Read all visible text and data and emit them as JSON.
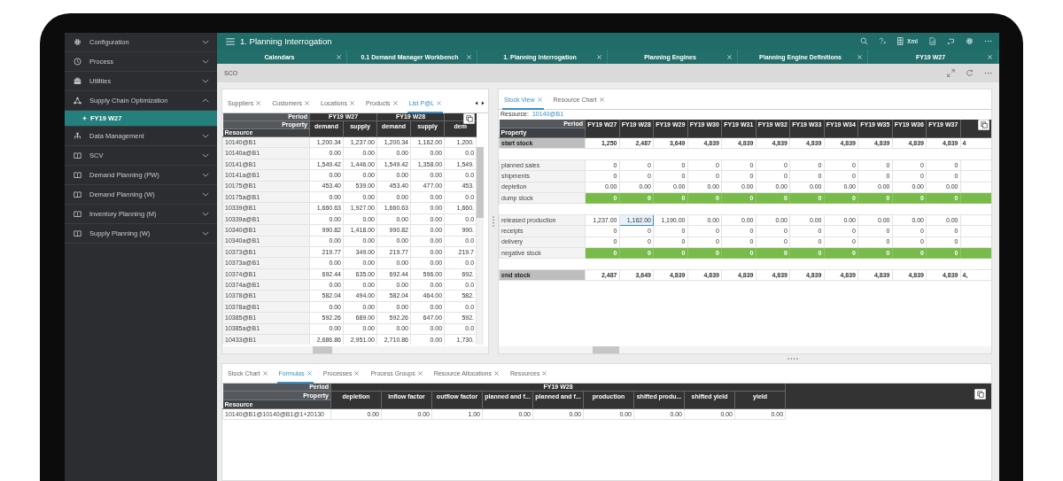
{
  "sidebar": {
    "items": [
      {
        "label": "Configuration",
        "expanded": false
      },
      {
        "label": "Process",
        "expanded": false
      },
      {
        "label": "Utilities",
        "expanded": false
      },
      {
        "label": "Supply Chain Optimization",
        "expanded": true,
        "children": [
          {
            "label": "FY19 W27",
            "selected": true
          }
        ]
      },
      {
        "label": "Data Management",
        "expanded": false
      },
      {
        "label": "SCV",
        "expanded": false
      },
      {
        "label": "Demand Planning (PW)",
        "expanded": false
      },
      {
        "label": "Demand Planning (W)",
        "expanded": false
      },
      {
        "label": "Inventory Planning (M)",
        "expanded": false
      },
      {
        "label": "Supply Planning (W)",
        "expanded": false
      }
    ]
  },
  "window": {
    "title": "1. Planning Interrogation",
    "xml_button": "Xml"
  },
  "tabs": [
    {
      "label": "Calendars"
    },
    {
      "label": "0.1 Demand Manager Workbench"
    },
    {
      "label": "1. Planning Interrogation"
    },
    {
      "label": "Planning Engines"
    },
    {
      "label": "Planning Engine Definitions"
    },
    {
      "label": "FY19 W27"
    }
  ],
  "breadcrumb": "SCO",
  "left_panel": {
    "tabs": [
      {
        "label": "Suppliers",
        "selected": false
      },
      {
        "label": "Customers",
        "selected": false
      },
      {
        "label": "Locations",
        "selected": false
      },
      {
        "label": "Products",
        "selected": false
      },
      {
        "label": "List P@L",
        "selected": true
      }
    ],
    "table": {
      "period_label": "Period",
      "property_label": "Property",
      "resource_label": "Resource",
      "periods": [
        {
          "label": "FY19 W27",
          "columns": [
            "demand",
            "supply"
          ]
        },
        {
          "label": "FY19 W28",
          "columns": [
            "demand",
            "supply"
          ]
        },
        {
          "columns": [
            "dem"
          ]
        }
      ],
      "rows": [
        {
          "resource": "10140@B1",
          "values": [
            "1,200.34",
            "1,237.00",
            "1,200.34",
            "1,162.00",
            "1,200."
          ]
        },
        {
          "resource": "10140a@B1",
          "values": [
            "0.00",
            "0.00",
            "0.00",
            "0.00",
            "0.0"
          ]
        },
        {
          "resource": "10141@B1",
          "values": [
            "1,549.42",
            "1,446.00",
            "1,549.42",
            "1,358.00",
            "1,549."
          ]
        },
        {
          "resource": "10141a@B1",
          "values": [
            "0.00",
            "0.00",
            "0.00",
            "0.00",
            "0.0"
          ]
        },
        {
          "resource": "10175@B1",
          "values": [
            "453.40",
            "539.00",
            "453.40",
            "477.00",
            "453."
          ]
        },
        {
          "resource": "10175a@B1",
          "values": [
            "0.00",
            "0.00",
            "0.00",
            "0.00",
            "0.0"
          ]
        },
        {
          "resource": "10339@B1",
          "values": [
            "1,660.63",
            "1,927.00",
            "1,660.63",
            "0.00",
            "1,660."
          ]
        },
        {
          "resource": "10339a@B1",
          "values": [
            "0.00",
            "0.00",
            "0.00",
            "0.00",
            "0.0"
          ]
        },
        {
          "resource": "10340@B1",
          "values": [
            "990.82",
            "1,418.00",
            "990.82",
            "0.00",
            "990."
          ]
        },
        {
          "resource": "10340a@B1",
          "values": [
            "0.00",
            "0.00",
            "0.00",
            "0.00",
            "0.0"
          ]
        },
        {
          "resource": "10373@B1",
          "values": [
            "219.77",
            "349.00",
            "219.77",
            "0.00",
            "219.7"
          ]
        },
        {
          "resource": "10373a@B1",
          "values": [
            "0.00",
            "0.00",
            "0.00",
            "0.00",
            "0.0"
          ]
        },
        {
          "resource": "10374@B1",
          "values": [
            "692.44",
            "635.00",
            "692.44",
            "596.00",
            "692."
          ]
        },
        {
          "resource": "10374a@B1",
          "values": [
            "0.00",
            "0.00",
            "0.00",
            "0.00",
            "0.0"
          ]
        },
        {
          "resource": "10378@B1",
          "values": [
            "582.04",
            "494.00",
            "582.04",
            "464.00",
            "582."
          ]
        },
        {
          "resource": "10378a@B1",
          "values": [
            "0.00",
            "0.00",
            "0.00",
            "0.00",
            "0.0"
          ]
        },
        {
          "resource": "10385@B1",
          "values": [
            "592.26",
            "689.00",
            "592.26",
            "647.00",
            "592."
          ]
        },
        {
          "resource": "10385a@B1",
          "values": [
            "0.00",
            "0.00",
            "0.00",
            "0.00",
            "0.0"
          ]
        },
        {
          "resource": "10433@B1",
          "values": [
            "2,686.86",
            "2,951.00",
            "2,710.86",
            "0.00",
            "1,730."
          ]
        }
      ]
    }
  },
  "right_panel": {
    "tabs": [
      {
        "label": "Stock View",
        "selected": true
      },
      {
        "label": "Resource Chart",
        "selected": false
      }
    ],
    "resource_label": "Resource:",
    "resource_value": "10140@B1",
    "table": {
      "period_label": "Period",
      "property_label": "Property",
      "periods": [
        "FY19 W27",
        "FY19 W28",
        "FY19 W29",
        "FY19 W30",
        "FY19 W31",
        "FY19 W32",
        "FY19 W33",
        "FY19 W34",
        "FY19 W35",
        "FY19 W36",
        "FY19 W37"
      ],
      "rows": [
        {
          "kind": "total",
          "label": "start stock",
          "overflow": "4",
          "cells": [
            {
              "text": "1,250",
              "selected": false
            },
            {
              "text": "2,487",
              "selected": false
            },
            {
              "text": "3,649",
              "selected": false
            },
            {
              "text": "4,839",
              "selected": false
            },
            {
              "text": "4,839",
              "selected": false
            },
            {
              "text": "4,839",
              "selected": false
            },
            {
              "text": "4,839",
              "selected": false
            },
            {
              "text": "4,839",
              "selected": false
            },
            {
              "text": "4,839",
              "selected": false
            },
            {
              "text": "4,839",
              "selected": false
            },
            {
              "text": "4,839",
              "selected": false
            }
          ]
        },
        {
          "kind": "spacer"
        },
        {
          "kind": "plain",
          "label": "planned sales",
          "cells": [
            {
              "text": "0",
              "selected": false
            },
            {
              "text": "0",
              "selected": false
            },
            {
              "text": "0",
              "selected": false
            },
            {
              "text": "0",
              "selected": false
            },
            {
              "text": "0",
              "selected": false
            },
            {
              "text": "0",
              "selected": false
            },
            {
              "text": "0",
              "selected": false
            },
            {
              "text": "0",
              "selected": false
            },
            {
              "text": "0",
              "selected": false
            },
            {
              "text": "0",
              "selected": false
            },
            {
              "text": "0",
              "selected": false
            }
          ]
        },
        {
          "kind": "plain",
          "label": "shipments",
          "cells": [
            {
              "text": "0",
              "selected": false
            },
            {
              "text": "0",
              "selected": false
            },
            {
              "text": "0",
              "selected": false
            },
            {
              "text": "0",
              "selected": false
            },
            {
              "text": "0",
              "selected": false
            },
            {
              "text": "0",
              "selected": false
            },
            {
              "text": "0",
              "selected": false
            },
            {
              "text": "0",
              "selected": false
            },
            {
              "text": "0",
              "selected": false
            },
            {
              "text": "0",
              "selected": false
            },
            {
              "text": "0",
              "selected": false
            }
          ]
        },
        {
          "kind": "plain",
          "label": "depletion",
          "cells": [
            {
              "text": "0.00",
              "selected": false
            },
            {
              "text": "0.00",
              "selected": false
            },
            {
              "text": "0.00",
              "selected": false
            },
            {
              "text": "0.00",
              "selected": false
            },
            {
              "text": "0.00",
              "selected": false
            },
            {
              "text": "0.00",
              "selected": false
            },
            {
              "text": "0.00",
              "selected": false
            },
            {
              "text": "0.00",
              "selected": false
            },
            {
              "text": "0.00",
              "selected": false
            },
            {
              "text": "0.00",
              "selected": false
            },
            {
              "text": "0.00",
              "selected": false
            }
          ]
        },
        {
          "kind": "flag",
          "label": "dump stock",
          "cells": [
            {
              "text": "0",
              "selected": false
            },
            {
              "text": "0",
              "selected": false
            },
            {
              "text": "0",
              "selected": false
            },
            {
              "text": "0",
              "selected": false
            },
            {
              "text": "0",
              "selected": false
            },
            {
              "text": "0",
              "selected": false
            },
            {
              "text": "0",
              "selected": false
            },
            {
              "text": "0",
              "selected": false
            },
            {
              "text": "0",
              "selected": false
            },
            {
              "text": "0",
              "selected": false
            },
            {
              "text": "0",
              "selected": false
            }
          ]
        },
        {
          "kind": "spacer"
        },
        {
          "kind": "plain",
          "label": "released production",
          "cells": [
            {
              "text": "1,237.00",
              "selected": false
            },
            {
              "text": "1,162.00",
              "selected": true
            },
            {
              "text": "1,190.00",
              "selected": false
            },
            {
              "text": "0.00",
              "selected": false
            },
            {
              "text": "0.00",
              "selected": false
            },
            {
              "text": "0.00",
              "selected": false
            },
            {
              "text": "0.00",
              "selected": false
            },
            {
              "text": "0.00",
              "selected": false
            },
            {
              "text": "0.00",
              "selected": false
            },
            {
              "text": "0.00",
              "selected": false
            },
            {
              "text": "0.00",
              "selected": false
            }
          ]
        },
        {
          "kind": "plain",
          "label": "receipts",
          "cells": [
            {
              "text": "0",
              "selected": false
            },
            {
              "text": "0",
              "selected": false
            },
            {
              "text": "0",
              "selected": false
            },
            {
              "text": "0",
              "selected": false
            },
            {
              "text": "0",
              "selected": false
            },
            {
              "text": "0",
              "selected": false
            },
            {
              "text": "0",
              "selected": false
            },
            {
              "text": "0",
              "selected": false
            },
            {
              "text": "0",
              "selected": false
            },
            {
              "text": "0",
              "selected": false
            },
            {
              "text": "0",
              "selected": false
            }
          ]
        },
        {
          "kind": "plain",
          "label": "delivery",
          "cells": [
            {
              "text": "0",
              "selected": false
            },
            {
              "text": "0",
              "selected": false
            },
            {
              "text": "0",
              "selected": false
            },
            {
              "text": "0",
              "selected": false
            },
            {
              "text": "0",
              "selected": false
            },
            {
              "text": "0",
              "selected": false
            },
            {
              "text": "0",
              "selected": false
            },
            {
              "text": "0",
              "selected": false
            },
            {
              "text": "0",
              "selected": false
            },
            {
              "text": "0",
              "selected": false
            },
            {
              "text": "0",
              "selected": false
            }
          ]
        },
        {
          "kind": "flag",
          "label": "negative stock",
          "cells": [
            {
              "text": "0",
              "selected": false
            },
            {
              "text": "0",
              "selected": false
            },
            {
              "text": "0",
              "selected": false
            },
            {
              "text": "0",
              "selected": false
            },
            {
              "text": "0",
              "selected": false
            },
            {
              "text": "0",
              "selected": false
            },
            {
              "text": "0",
              "selected": false
            },
            {
              "text": "0",
              "selected": false
            },
            {
              "text": "0",
              "selected": false
            },
            {
              "text": "0",
              "selected": false
            },
            {
              "text": "0",
              "selected": false
            }
          ]
        },
        {
          "kind": "spacer"
        },
        {
          "kind": "total",
          "label": "end stock",
          "overflow": "4,",
          "cells": [
            {
              "text": "2,487",
              "selected": false
            },
            {
              "text": "3,649",
              "selected": false
            },
            {
              "text": "4,839",
              "selected": false
            },
            {
              "text": "4,839",
              "selected": false
            },
            {
              "text": "4,839",
              "selected": false
            },
            {
              "text": "4,839",
              "selected": false
            },
            {
              "text": "4,839",
              "selected": false
            },
            {
              "text": "4,839",
              "selected": false
            },
            {
              "text": "4,839",
              "selected": false
            },
            {
              "text": "4,839",
              "selected": false
            },
            {
              "text": "4,839",
              "selected": false
            }
          ]
        }
      ]
    }
  },
  "bottom_panel": {
    "tabs": [
      {
        "label": "Stock Chart",
        "selected": false
      },
      {
        "label": "Formulas",
        "selected": true
      },
      {
        "label": "Processes",
        "selected": false
      },
      {
        "label": "Process Groups",
        "selected": false
      },
      {
        "label": "Resource Allocations",
        "selected": false
      },
      {
        "label": "Resources",
        "selected": false
      }
    ],
    "table": {
      "period_label": "Period",
      "property_label": "Property",
      "resource_label": "Resource",
      "period": "FY19 W28",
      "columns": [
        "depletion",
        "inflow factor",
        "outflow factor",
        "planned and f...",
        "planned and f...",
        "production",
        "shifted produ...",
        "shifted yield",
        "yield"
      ],
      "rows": [
        {
          "resource": "10140@B1@10140@B1@1+20130",
          "values": [
            "0.00",
            "0.00",
            "1.00",
            "0.00",
            "0.00",
            "0.00",
            "0.00",
            "0.00",
            "0.00"
          ]
        }
      ]
    }
  }
}
